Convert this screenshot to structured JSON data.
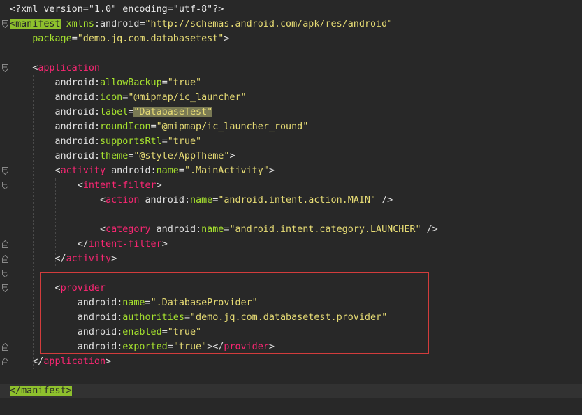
{
  "colors": {
    "background": "#282828",
    "tag": "#f92672",
    "attribute": "#a6e22e",
    "value": "#e6db74",
    "highlight_box": "#d23c3c",
    "matched_tag_bg": "#8ec02d",
    "selection_bg": "#7a7a54"
  },
  "code_lines": [
    {
      "tokens": [
        {
          "text": "<?xml version=\"1.0\" encoding=\"utf-8\"?>",
          "type": "pi"
        }
      ]
    },
    {
      "tokens": [
        {
          "text": "<",
          "type": "punc",
          "hl": "tag"
        },
        {
          "text": "manifest",
          "type": "tag",
          "hl": "tag"
        },
        {
          "text": " ",
          "type": "default"
        },
        {
          "text": "xmlns",
          "type": "attr"
        },
        {
          "text": ":",
          "type": "colon"
        },
        {
          "text": "android",
          "type": "ns"
        },
        {
          "text": "=",
          "type": "punc"
        },
        {
          "text": "\"http://schemas.android.com/apk/res/android\"",
          "type": "val"
        }
      ]
    },
    {
      "tokens": [
        {
          "text": "    ",
          "type": "default"
        },
        {
          "text": "package",
          "type": "attr"
        },
        {
          "text": "=",
          "type": "punc"
        },
        {
          "text": "\"demo.jq.com.databasetest\"",
          "type": "val"
        },
        {
          "text": ">",
          "type": "punc"
        }
      ]
    },
    {
      "tokens": []
    },
    {
      "tokens": [
        {
          "text": "    ",
          "type": "default"
        },
        {
          "text": "<",
          "type": "punc"
        },
        {
          "text": "application",
          "type": "tag"
        }
      ]
    },
    {
      "tokens": [
        {
          "text": "        ",
          "type": "default"
        },
        {
          "text": "android",
          "type": "ns"
        },
        {
          "text": ":",
          "type": "colon"
        },
        {
          "text": "allowBackup",
          "type": "attr"
        },
        {
          "text": "=",
          "type": "punc"
        },
        {
          "text": "\"true\"",
          "type": "val"
        }
      ]
    },
    {
      "tokens": [
        {
          "text": "        ",
          "type": "default"
        },
        {
          "text": "android",
          "type": "ns"
        },
        {
          "text": ":",
          "type": "colon"
        },
        {
          "text": "icon",
          "type": "attr"
        },
        {
          "text": "=",
          "type": "punc"
        },
        {
          "text": "\"@mipmap/ic_launcher\"",
          "type": "val"
        }
      ]
    },
    {
      "tokens": [
        {
          "text": "        ",
          "type": "default"
        },
        {
          "text": "android",
          "type": "ns"
        },
        {
          "text": ":",
          "type": "colon"
        },
        {
          "text": "label",
          "type": "attr"
        },
        {
          "text": "=",
          "type": "punc"
        },
        {
          "text": "\"DatabaseTest\"",
          "type": "val",
          "hl": "sel"
        }
      ]
    },
    {
      "tokens": [
        {
          "text": "        ",
          "type": "default"
        },
        {
          "text": "android",
          "type": "ns"
        },
        {
          "text": ":",
          "type": "colon"
        },
        {
          "text": "roundIcon",
          "type": "attr"
        },
        {
          "text": "=",
          "type": "punc"
        },
        {
          "text": "\"@mipmap/ic_launcher_round\"",
          "type": "val"
        }
      ]
    },
    {
      "tokens": [
        {
          "text": "        ",
          "type": "default"
        },
        {
          "text": "android",
          "type": "ns"
        },
        {
          "text": ":",
          "type": "colon"
        },
        {
          "text": "supportsRtl",
          "type": "attr"
        },
        {
          "text": "=",
          "type": "punc"
        },
        {
          "text": "\"true\"",
          "type": "val"
        }
      ]
    },
    {
      "tokens": [
        {
          "text": "        ",
          "type": "default"
        },
        {
          "text": "android",
          "type": "ns"
        },
        {
          "text": ":",
          "type": "colon"
        },
        {
          "text": "theme",
          "type": "attr"
        },
        {
          "text": "=",
          "type": "punc"
        },
        {
          "text": "\"@style/AppTheme\"",
          "type": "val"
        },
        {
          "text": ">",
          "type": "punc"
        }
      ]
    },
    {
      "tokens": [
        {
          "text": "        ",
          "type": "default"
        },
        {
          "text": "<",
          "type": "punc"
        },
        {
          "text": "activity",
          "type": "tag"
        },
        {
          "text": " ",
          "type": "default"
        },
        {
          "text": "android",
          "type": "ns"
        },
        {
          "text": ":",
          "type": "colon"
        },
        {
          "text": "name",
          "type": "attr"
        },
        {
          "text": "=",
          "type": "punc"
        },
        {
          "text": "\".MainActivity\"",
          "type": "val"
        },
        {
          "text": ">",
          "type": "punc"
        }
      ]
    },
    {
      "tokens": [
        {
          "text": "            ",
          "type": "default"
        },
        {
          "text": "<",
          "type": "punc"
        },
        {
          "text": "intent-filter",
          "type": "tag"
        },
        {
          "text": ">",
          "type": "punc"
        }
      ]
    },
    {
      "tokens": [
        {
          "text": "                ",
          "type": "default"
        },
        {
          "text": "<",
          "type": "punc"
        },
        {
          "text": "action",
          "type": "tag"
        },
        {
          "text": " ",
          "type": "default"
        },
        {
          "text": "android",
          "type": "ns"
        },
        {
          "text": ":",
          "type": "colon"
        },
        {
          "text": "name",
          "type": "attr"
        },
        {
          "text": "=",
          "type": "punc"
        },
        {
          "text": "\"android.intent.action.MAIN\"",
          "type": "val"
        },
        {
          "text": " />",
          "type": "punc"
        }
      ]
    },
    {
      "tokens": []
    },
    {
      "tokens": [
        {
          "text": "                ",
          "type": "default"
        },
        {
          "text": "<",
          "type": "punc"
        },
        {
          "text": "category",
          "type": "tag"
        },
        {
          "text": " ",
          "type": "default"
        },
        {
          "text": "android",
          "type": "ns"
        },
        {
          "text": ":",
          "type": "colon"
        },
        {
          "text": "name",
          "type": "attr"
        },
        {
          "text": "=",
          "type": "punc"
        },
        {
          "text": "\"android.intent.category.LAUNCHER\"",
          "type": "val"
        },
        {
          "text": " />",
          "type": "punc"
        }
      ]
    },
    {
      "tokens": [
        {
          "text": "            ",
          "type": "default"
        },
        {
          "text": "</",
          "type": "punc"
        },
        {
          "text": "intent-filter",
          "type": "tag"
        },
        {
          "text": ">",
          "type": "punc"
        }
      ]
    },
    {
      "tokens": [
        {
          "text": "        ",
          "type": "default"
        },
        {
          "text": "</",
          "type": "punc"
        },
        {
          "text": "activity",
          "type": "tag"
        },
        {
          "text": ">",
          "type": "punc"
        }
      ]
    },
    {
      "tokens": []
    },
    {
      "tokens": [
        {
          "text": "        ",
          "type": "default"
        },
        {
          "text": "<",
          "type": "punc"
        },
        {
          "text": "provider",
          "type": "tag"
        }
      ]
    },
    {
      "tokens": [
        {
          "text": "            ",
          "type": "default"
        },
        {
          "text": "android",
          "type": "ns"
        },
        {
          "text": ":",
          "type": "colon"
        },
        {
          "text": "name",
          "type": "attr"
        },
        {
          "text": "=",
          "type": "punc"
        },
        {
          "text": "\".DatabaseProvider\"",
          "type": "val"
        }
      ]
    },
    {
      "tokens": [
        {
          "text": "            ",
          "type": "default"
        },
        {
          "text": "android",
          "type": "ns"
        },
        {
          "text": ":",
          "type": "colon"
        },
        {
          "text": "authorities",
          "type": "attr"
        },
        {
          "text": "=",
          "type": "punc"
        },
        {
          "text": "\"demo.jq.com.databasetest.provider\"",
          "type": "val"
        }
      ]
    },
    {
      "tokens": [
        {
          "text": "            ",
          "type": "default"
        },
        {
          "text": "android",
          "type": "ns"
        },
        {
          "text": ":",
          "type": "colon"
        },
        {
          "text": "enabled",
          "type": "attr"
        },
        {
          "text": "=",
          "type": "punc"
        },
        {
          "text": "\"true\"",
          "type": "val"
        }
      ]
    },
    {
      "tokens": [
        {
          "text": "            ",
          "type": "default"
        },
        {
          "text": "android",
          "type": "ns"
        },
        {
          "text": ":",
          "type": "colon"
        },
        {
          "text": "exported",
          "type": "attr"
        },
        {
          "text": "=",
          "type": "punc"
        },
        {
          "text": "\"true\"",
          "type": "val"
        },
        {
          "text": "></",
          "type": "punc"
        },
        {
          "text": "provider",
          "type": "tag"
        },
        {
          "text": ">",
          "type": "punc"
        }
      ]
    },
    {
      "tokens": [
        {
          "text": "    ",
          "type": "default"
        },
        {
          "text": "</",
          "type": "punc"
        },
        {
          "text": "application",
          "type": "tag"
        },
        {
          "text": ">",
          "type": "punc"
        }
      ]
    },
    {
      "tokens": []
    },
    {
      "tokens": [
        {
          "text": "</",
          "type": "punc",
          "hl": "tag"
        },
        {
          "text": "manifest",
          "type": "tag",
          "hl": "tag"
        },
        {
          "text": ">",
          "type": "punc",
          "hl": "tag"
        }
      ]
    }
  ]
}
